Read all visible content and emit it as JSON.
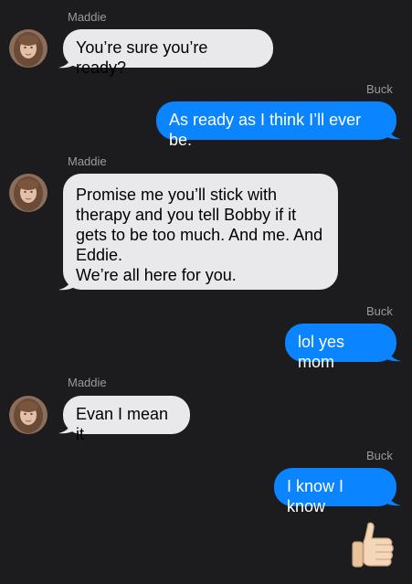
{
  "colors": {
    "background": "#1c1c1e",
    "incoming_bubble": "#e9e9eb",
    "outgoing_bubble": "#0a84ff",
    "sender_name": "#9a9a9f"
  },
  "messages": [
    {
      "direction": "incoming",
      "sender": "Maddie",
      "text": "You’re sure you’re ready?"
    },
    {
      "direction": "outgoing",
      "sender": "Buck",
      "text": "As ready as I think I’ll ever be."
    },
    {
      "direction": "incoming",
      "sender": "Maddie",
      "text": "Promise me you’ll stick with\ntherapy and you tell Bobby if it\ngets to be too much. And me. And\nEddie.\nWe’re all here for you."
    },
    {
      "direction": "outgoing",
      "sender": "Buck",
      "text": "lol yes mom"
    },
    {
      "direction": "incoming",
      "sender": "Maddie",
      "text": "Evan I mean it"
    },
    {
      "direction": "outgoing",
      "sender": "Buck",
      "text": "I know I know"
    }
  ],
  "reaction": {
    "icon": "thumbs-up-icon"
  }
}
